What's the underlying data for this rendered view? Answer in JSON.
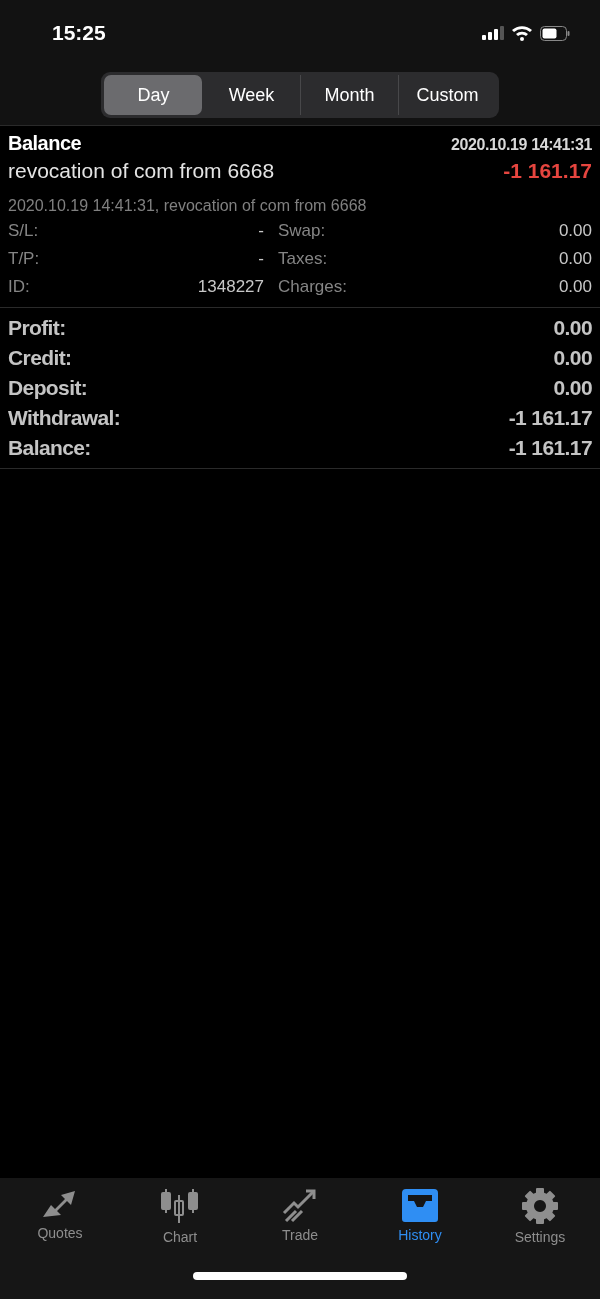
{
  "status_bar": {
    "time": "15:25"
  },
  "period_tabs": [
    {
      "label": "Day",
      "selected": true
    },
    {
      "label": "Week",
      "selected": false
    },
    {
      "label": "Month",
      "selected": false
    },
    {
      "label": "Custom",
      "selected": false
    }
  ],
  "deal": {
    "type": "Balance",
    "time": "2020.10.19 14:41:31",
    "comment": "revocation of com from 6668",
    "amount": "-1 161.17",
    "negative": true,
    "description": "2020.10.19 14:41:31, revocation of com from 6668",
    "details": [
      {
        "label": "S/L:",
        "value": "-",
        "label2": "Swap:",
        "value2": "0.00"
      },
      {
        "label": "T/P:",
        "value": "-",
        "label2": "Taxes:",
        "value2": "0.00"
      },
      {
        "label": "ID:",
        "value": "1348227",
        "label2": "Charges:",
        "value2": "0.00"
      }
    ]
  },
  "summary": [
    {
      "label": "Profit:",
      "value": "0.00"
    },
    {
      "label": "Credit:",
      "value": "0.00"
    },
    {
      "label": "Deposit:",
      "value": "0.00"
    },
    {
      "label": "Withdrawal:",
      "value": "-1 161.17"
    },
    {
      "label": "Balance:",
      "value": "-1 161.17"
    }
  ],
  "tab_bar": [
    {
      "kind": "quotes",
      "label": "Quotes",
      "selected": false
    },
    {
      "kind": "chart",
      "label": "Chart",
      "selected": false
    },
    {
      "kind": "trade",
      "label": "Trade",
      "selected": false
    },
    {
      "kind": "history",
      "label": "History",
      "selected": true
    },
    {
      "kind": "settings",
      "label": "Settings",
      "selected": false
    }
  ]
}
